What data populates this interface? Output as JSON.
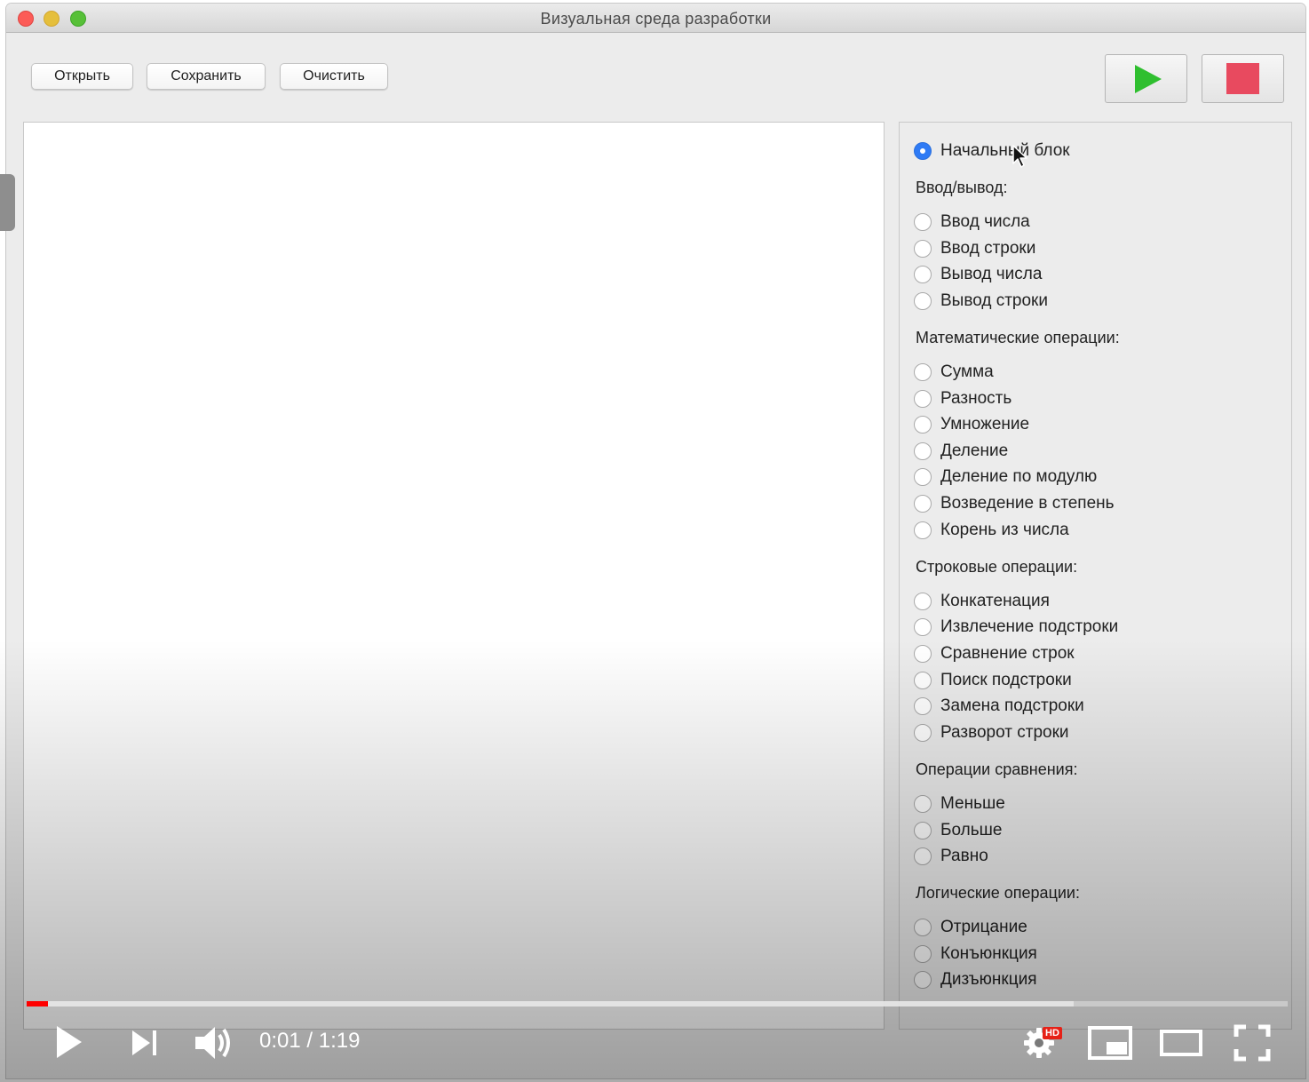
{
  "window": {
    "title": "Визуальная среда разработки"
  },
  "toolbar": {
    "open_label": "Открыть",
    "save_label": "Сохранить",
    "clear_label": "Очистить",
    "run_icon": "play-triangle",
    "run_color": "#2fbf2f",
    "stop_icon": "stop-square",
    "stop_color": "#e84a5f"
  },
  "palette": {
    "start": {
      "label": "Начальный блок",
      "checked": true
    },
    "groups": [
      {
        "title": "Ввод/вывод:",
        "items": [
          "Ввод числа",
          "Ввод строки",
          "Вывод числа",
          "Вывод строки"
        ]
      },
      {
        "title": "Математические операции:",
        "items": [
          "Сумма",
          "Разность",
          "Умножение",
          "Деление",
          "Деление по модулю",
          "Возведение в степень",
          "Корень из числа"
        ]
      },
      {
        "title": "Строковые операции:",
        "items": [
          "Конкатенация",
          "Извлечение подстроки",
          "Сравнение строк",
          "Поиск подстроки",
          "Замена подстроки",
          "Разворот строки"
        ]
      },
      {
        "title": "Операции сравнения:",
        "items": [
          "Меньше",
          "Больше",
          "Равно"
        ]
      },
      {
        "title": "Логические операции:",
        "items": [
          "Отрицание",
          "Конъюнкция",
          "Дизъюнкция"
        ]
      }
    ]
  },
  "player": {
    "time_display": "0:01 / 1:19",
    "played_fraction": 0.017,
    "buffered_fraction": 0.83,
    "hd_badge": "HD",
    "accent": "#ff0000"
  }
}
